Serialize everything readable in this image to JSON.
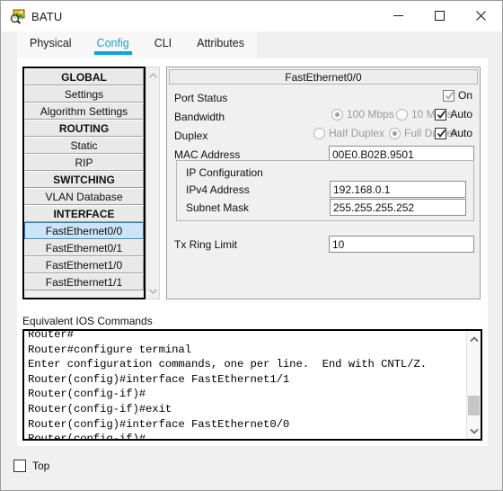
{
  "window": {
    "title": "BATU",
    "icon": "packet-tracer-device-icon",
    "controls": {
      "minimize": "minimize-icon",
      "maximize": "maximize-icon",
      "close": "close-icon"
    }
  },
  "tabs": [
    {
      "label": "Physical",
      "active": false
    },
    {
      "label": "Config",
      "active": true
    },
    {
      "label": "CLI",
      "active": false
    },
    {
      "label": "Attributes",
      "active": false
    }
  ],
  "sidebar": {
    "items": [
      {
        "label": "GLOBAL",
        "type": "header",
        "selected": false
      },
      {
        "label": "Settings",
        "type": "item",
        "selected": false
      },
      {
        "label": "Algorithm Settings",
        "type": "item",
        "selected": false
      },
      {
        "label": "ROUTING",
        "type": "header",
        "selected": false
      },
      {
        "label": "Static",
        "type": "item",
        "selected": false
      },
      {
        "label": "RIP",
        "type": "item",
        "selected": false
      },
      {
        "label": "SWITCHING",
        "type": "header",
        "selected": false
      },
      {
        "label": "VLAN Database",
        "type": "item",
        "selected": false
      },
      {
        "label": "INTERFACE",
        "type": "header",
        "selected": false
      },
      {
        "label": "FastEthernet0/0",
        "type": "item",
        "selected": true
      },
      {
        "label": "FastEthernet0/1",
        "type": "item",
        "selected": false
      },
      {
        "label": "FastEthernet1/0",
        "type": "item",
        "selected": false
      },
      {
        "label": "FastEthernet1/1",
        "type": "item",
        "selected": false
      }
    ],
    "scrollbar": {
      "up": "scroll-up-icon",
      "down": "scroll-down-icon"
    }
  },
  "config_panel": {
    "title": "FastEthernet0/0",
    "port_status": {
      "label": "Port Status",
      "on_label": "On",
      "checked": true
    },
    "bandwidth": {
      "label": "Bandwidth",
      "option_100": "100 Mbps",
      "option_10": "10 Mbps",
      "selected": "100 Mbps",
      "auto_label": "Auto",
      "auto_checked": true
    },
    "duplex": {
      "label": "Duplex",
      "option_half": "Half Duplex",
      "option_full": "Full Duplex",
      "selected": "Full Duplex",
      "auto_label": "Auto",
      "auto_checked": true
    },
    "mac_address": {
      "label": "MAC Address",
      "value": "00E0.B02B.9501"
    },
    "ip_configuration": {
      "group_label": "IP Configuration",
      "ipv4": {
        "label": "IPv4 Address",
        "value": "192.168.0.1"
      },
      "subnet": {
        "label": "Subnet Mask",
        "value": "255.255.255.252"
      }
    },
    "tx_ring_limit": {
      "label": "Tx Ring Limit",
      "value": "10"
    }
  },
  "ios": {
    "label": "Equivalent IOS Commands",
    "text": "Router#\nRouter#configure terminal\nEnter configuration commands, one per line.  End with CNTL/Z.\nRouter(config)#interface FastEthernet1/1\nRouter(config-if)#\nRouter(config-if)#exit\nRouter(config)#interface FastEthernet0/0\nRouter(config-if)#",
    "scrollbar": {
      "up": "scroll-up-icon",
      "down": "scroll-down-icon"
    }
  },
  "footer": {
    "top_checkbox": {
      "label": "Top",
      "checked": false
    }
  },
  "colors": {
    "accent": "#0aa3dd",
    "selection": "#cce4f7",
    "selection_border": "#3c7fb1",
    "panel_bg": "#f0f0f0",
    "disabled_text": "#9a9a9a"
  }
}
